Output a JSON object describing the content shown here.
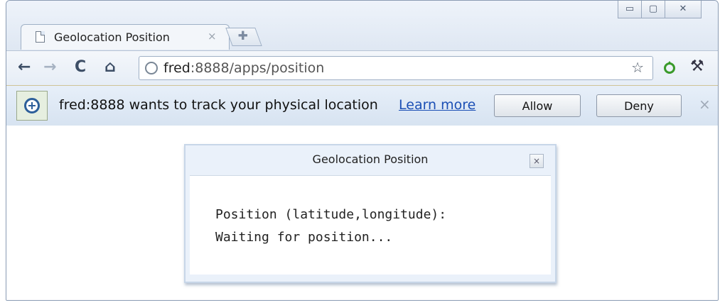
{
  "window": {
    "minimize_icon": "minimize-icon",
    "maximize_icon": "maximize-icon",
    "close_icon": "close-icon"
  },
  "tab": {
    "title": "Geolocation Position",
    "close_glyph": "×",
    "new_tab_glyph": "✚"
  },
  "toolbar": {
    "back": "←",
    "forward": "→",
    "reload": "C",
    "home": "⌂",
    "url_host": "fred",
    "url_rest": ":8888/apps/position",
    "star": "☆",
    "wrench": "🔧"
  },
  "infobar": {
    "message": "fred:8888 wants to track your physical location",
    "learn_more": "Learn more",
    "allow_label": "Allow",
    "deny_label": "Deny",
    "close_glyph": "×"
  },
  "dialog": {
    "title": "Geolocation Position",
    "close_glyph": "×",
    "line1": "Position (latitude,longitude):",
    "line2": "Waiting for position..."
  },
  "colors": {
    "link": "#1b4fb5",
    "infobar_bg": "#dde7f3",
    "extension_green": "#3a9a2a"
  }
}
